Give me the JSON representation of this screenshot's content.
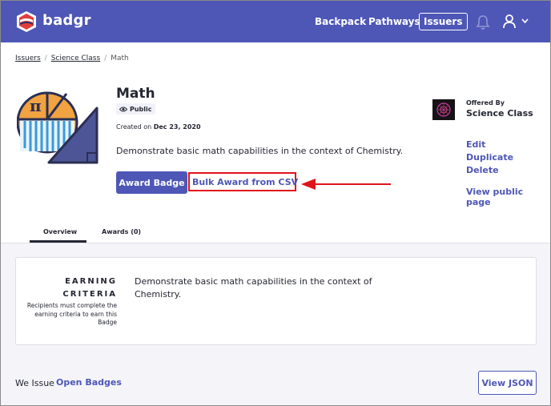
{
  "nav": {
    "logo_text": "badgr",
    "links": [
      "Backpack",
      "Pathways",
      "Issuers"
    ]
  },
  "breadcrumb": {
    "items": [
      "Issuers",
      "Science Class",
      "Math"
    ]
  },
  "badge": {
    "title": "Math",
    "visibility": "Public",
    "created_label": "Created on",
    "created_date": "Dec 23, 2020",
    "description": "Demonstrate basic math capabilities in the context of Chemistry.",
    "award_button": "Award Badge",
    "bulk_award_link": "Bulk Award from CSV"
  },
  "issuer": {
    "offered_by_label": "Offered By",
    "name": "Science Class",
    "actions": [
      "Edit",
      "Duplicate",
      "Delete"
    ],
    "view_public": "View public page"
  },
  "tabs": [
    "Overview",
    "Awards (0)"
  ],
  "criteria": {
    "title_line1": "EARNING",
    "title_line2": "CRITERIA",
    "subtitle": "Recipients must complete the earning criteria to earn this Badge",
    "description": "Demonstrate basic math capabilities in the context of Chemistry."
  },
  "footer": {
    "we_issue": "We Issue",
    "open_badges": "Open Badges",
    "view_json": "View JSON"
  },
  "colors": {
    "brand": "#4e57b6",
    "highlight": "#e0141b",
    "background_lower": "#f4f4f9"
  }
}
